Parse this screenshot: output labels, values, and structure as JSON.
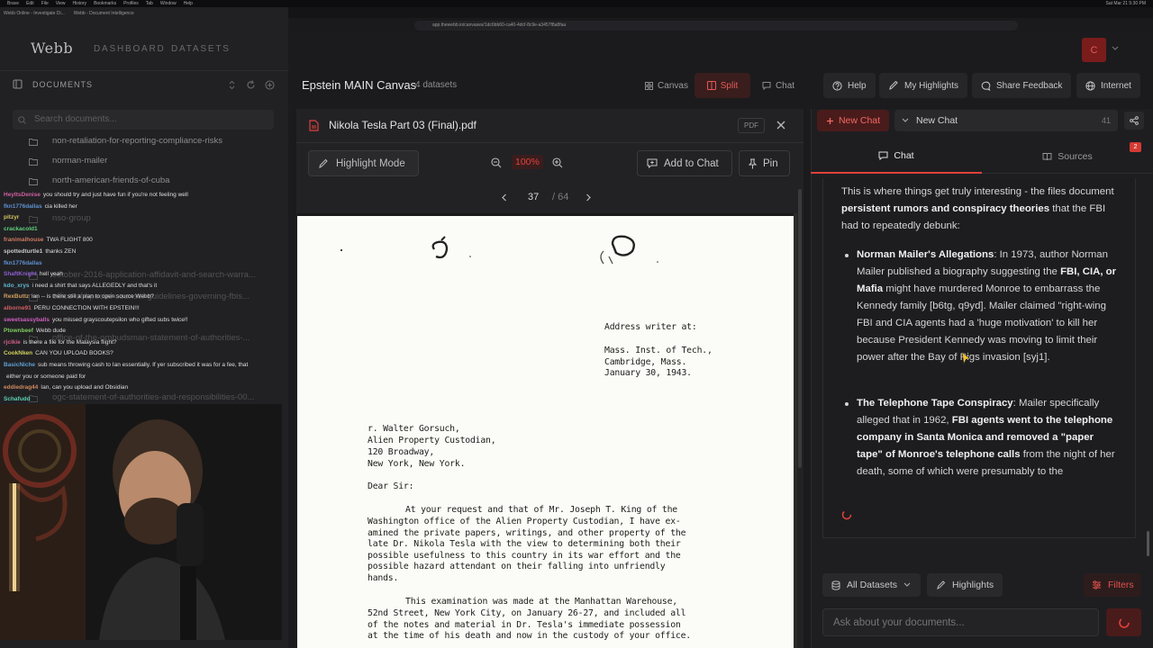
{
  "os_menubar": {
    "items": [
      "Brave",
      "Edit",
      "File",
      "View",
      "History",
      "Bookmarks",
      "Profiles",
      "Tab",
      "Window",
      "Help"
    ],
    "clock": "Sat Mar 21 5:30 PM"
  },
  "browser": {
    "tabs": [
      "Webb Online - Investigate Di...",
      "Webb - Document Intelligence"
    ],
    "url": "app.thewebb.io/canvases/1dc6bb60-ca40-4dcf-8c9e-a3457f8a8faa"
  },
  "sidebar": {
    "logo": "Webb",
    "nav": [
      "DASHBOARD",
      "DATASETS"
    ],
    "documents_title": "DOCUMENTS",
    "search_placeholder": "Search documents...",
    "folders": [
      "non-retaliation-for-reporting-compliance-risks",
      "norman-mailer",
      "north-american-friends-of-cuba",
      "nso-group",
      "october-2016-application-affidavit-and-search-warra...",
      "office-of-special-counsel-guidelines-governing-fbis...",
      "office-of-the-ombudsman-statement-of-authorities-...",
      "ogc-statement-of-authorities-and-responsibilities-00..."
    ]
  },
  "stream_chat": [
    {
      "user": "HeyItsDenise",
      "color": "#d05f9f",
      "text": "you should try and just have fun if you're not feeling well"
    },
    {
      "user": "fkn1776dallas",
      "color": "#5f8fd0",
      "text": "cia killed her"
    },
    {
      "user": "pitzyr",
      "color": "#d0c05f",
      "text": ""
    },
    {
      "user": "crackacold1",
      "color": "#5fd07a",
      "text": ""
    },
    {
      "user": "franimalhouse",
      "color": "#d07a5f",
      "text": "TWA FLIGHT 800"
    },
    {
      "user": "spottedturtle1",
      "color": "#c9c9c9",
      "text": "thanks ZEN"
    },
    {
      "user": "fkn1776dallas",
      "color": "#5f8fd0",
      "text": ""
    },
    {
      "user": "ShaftKnight",
      "color": "#8f5fd0",
      "text": "hell yeah"
    },
    {
      "user": "kdo_xrys",
      "color": "#5fb7d0",
      "text": "i need a shirt that says ALLEGEDLY and that's it"
    },
    {
      "user": "RexButtz",
      "color": "#d0a05f",
      "text": "ian -- is there still a plan to open source Webb?"
    },
    {
      "user": "alborne91",
      "color": "#d05f5f",
      "text": "PERU CONNECTION WITH EPSTEIN!!!"
    },
    {
      "user": "sweetsassyballs",
      "color": "#d05fc0",
      "text": "you missed grayscoutepsilon who gifted subs twice!!"
    },
    {
      "user": "Ptownbeef",
      "color": "#7fd05f",
      "text": "Webb dude"
    },
    {
      "user": "rjclkie",
      "color": "#d05f8a",
      "text": "is there a file for the Malaysia flight?"
    },
    {
      "user": "CookNken",
      "color": "#d0d05f",
      "text": "CAN YOU UPLOAD BOOKS?"
    },
    {
      "user": "BasicNiche",
      "color": "#5fa0d0",
      "text": "sub means throwing cash to Ian essentially. If yer subscribed it was for a fee, that"
    },
    {
      "user": "",
      "color": "#dedede",
      "text": "either you or someone paid for"
    },
    {
      "user": "eddiedrag44",
      "color": "#d08a5f",
      "text": "Ian, can you upload and Obsidian"
    },
    {
      "user": "Schafudd",
      "color": "#5fd0b0",
      "text": ""
    }
  ],
  "header": {
    "canvas_title": "Epstein MAIN Canvas",
    "dataset_count": "4 datasets",
    "view_modes": [
      "Canvas",
      "Split",
      "Chat"
    ],
    "active_view": "Split",
    "buttons": [
      "Help",
      "My Highlights",
      "Share Feedback",
      "Internet"
    ],
    "avatar": "C"
  },
  "document": {
    "filename": "Nikola Tesla Part 03 (Final).pdf",
    "badge": "PDF",
    "highlight_mode": "Highlight Mode",
    "zoom": "100%",
    "add_to_chat": "Add to Chat",
    "pin": "Pin",
    "page_current": "37",
    "page_total": "/ 64",
    "page_text": {
      "address_header": "Address writer at:",
      "address_lines": [
        "Mass. Inst. of Tech.,",
        "Cambridge, Mass.",
        "January 30, 1943."
      ],
      "recipient_lines": [
        "r. Walter Gorsuch,",
        "Alien Property Custodian,",
        "120 Broadway,",
        "New York, New York."
      ],
      "salutation": "Dear Sir:",
      "para1": [
        "At your request and that of Mr. Joseph T. King of the",
        "Washington office of the Alien Property Custodian, I have ex-",
        "amined the private papers, writings, and other property of the",
        "late Dr. Nikola Tesla with the view to determining both their",
        "possible usefulness to this country in its war effort and the",
        "possible hazard attendant on their falling into unfriendly",
        "hands."
      ],
      "para2": [
        "This examination was made at the Manhattan Warehouse,",
        "52nd Street, New York City, on January 26-27, and included all",
        "of the notes and material in Dr. Tesla's immediate possession",
        "at the time of his death and now in the custody of your office."
      ]
    }
  },
  "chat_panel": {
    "new_chat_button": "New Chat",
    "chat_selector": "New Chat",
    "chat_count": "41",
    "tabs": [
      "Chat",
      "Sources"
    ],
    "active_tab": "Chat",
    "sources_badge": "2",
    "response": {
      "intro_a": "This is where things get truly interesting - the files document ",
      "intro_b": "persistent rumors and conspiracy theories",
      "intro_c": " that the FBI had to repeatedly debunk:",
      "b1_title": "Norman Mailer's Allegations",
      "b1_a": ": In 1973, author Norman Mailer published a biography suggesting the ",
      "b1_b": "FBI, CIA, or Mafia",
      "b1_c": " might have murdered Monroe to embarrass the Kennedy family [b6tg, q9yd]. Mailer claimed \"right-wing FBI and CIA agents had a 'huge motivation' to kill her because President Kennedy was moving to limit their power after the Bay of Pigs invasion [syj1].",
      "b2_title": "The Telephone Tape Conspiracy",
      "b2_a": ": Mailer specifically alleged that in 1962, ",
      "b2_b": "FBI agents went to the telephone company in Santa Monica and removed a \"paper tape\" of Monroe's telephone calls",
      "b2_c": " from the night of her death, some of which were presumably to the"
    },
    "filters": {
      "datasets": "All Datasets",
      "highlights": "Highlights",
      "filters": "Filters"
    },
    "input_placeholder": "Ask about your documents..."
  },
  "colors": {
    "accent": "#e0413c",
    "background": "#1b1b1d",
    "panel": "#222225"
  }
}
